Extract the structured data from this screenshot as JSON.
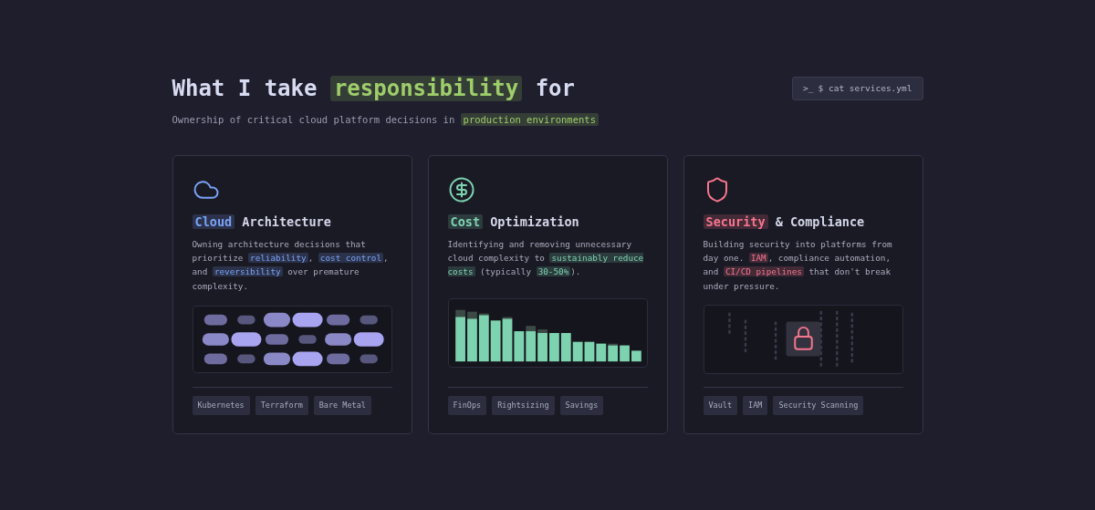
{
  "heading": {
    "segments": [
      {
        "text": "What I take ",
        "highlight": false
      },
      {
        "text": "responsibility",
        "highlight": true
      },
      {
        "text": " for",
        "highlight": false
      }
    ]
  },
  "command_button": {
    "prompt": ">_",
    "label": "$ cat services.yml"
  },
  "subtitle": {
    "segments": [
      {
        "text": "Ownership of critical cloud platform decisions in ",
        "highlight": false
      },
      {
        "text": "production environments",
        "highlight": true
      }
    ]
  },
  "cards": [
    {
      "kind": "architecture",
      "color": "#7aa2f7",
      "title": [
        {
          "text": "Cloud",
          "highlight": true
        },
        {
          "text": " Architecture",
          "highlight": false
        }
      ],
      "description": [
        {
          "text": "Owning architecture decisions that prioritize ",
          "highlight": false
        },
        {
          "text": "reliability",
          "highlight": true
        },
        {
          "text": ", ",
          "highlight": false
        },
        {
          "text": "cost control",
          "highlight": true
        },
        {
          "text": ", and ",
          "highlight": false
        },
        {
          "text": "reversibility",
          "highlight": true
        },
        {
          "text": " over premature complexity.",
          "highlight": false
        }
      ],
      "tags": [
        "Kubernetes",
        "Terraform",
        "Bare Metal"
      ]
    },
    {
      "kind": "cost",
      "color": "#7dd3b0",
      "title": [
        {
          "text": "Cost",
          "highlight": true
        },
        {
          "text": " Optimization",
          "highlight": false
        }
      ],
      "description": [
        {
          "text": "Identifying and removing unnecessary cloud complexity to ",
          "highlight": false
        },
        {
          "text": "sustainably reduce costs",
          "highlight": true
        },
        {
          "text": " (typically ",
          "highlight": false
        },
        {
          "text": "30-50%",
          "highlight": true
        },
        {
          "text": ").",
          "highlight": false
        }
      ],
      "tags": [
        "FinOps",
        "Rightsizing",
        "Savings"
      ]
    },
    {
      "kind": "security",
      "color": "#f7768e",
      "title": [
        {
          "text": "Security",
          "highlight": true
        },
        {
          "text": " & Compliance",
          "highlight": false
        }
      ],
      "description": [
        {
          "text": "Building security into platforms from day one. ",
          "highlight": false
        },
        {
          "text": "IAM",
          "highlight": true
        },
        {
          "text": ", compliance automation, and ",
          "highlight": false
        },
        {
          "text": "CI/CD pipelines",
          "highlight": true
        },
        {
          "text": " that don't break under pressure.",
          "highlight": false
        }
      ],
      "tags": [
        "Vault",
        "IAM",
        "Security Scanning"
      ]
    }
  ]
}
